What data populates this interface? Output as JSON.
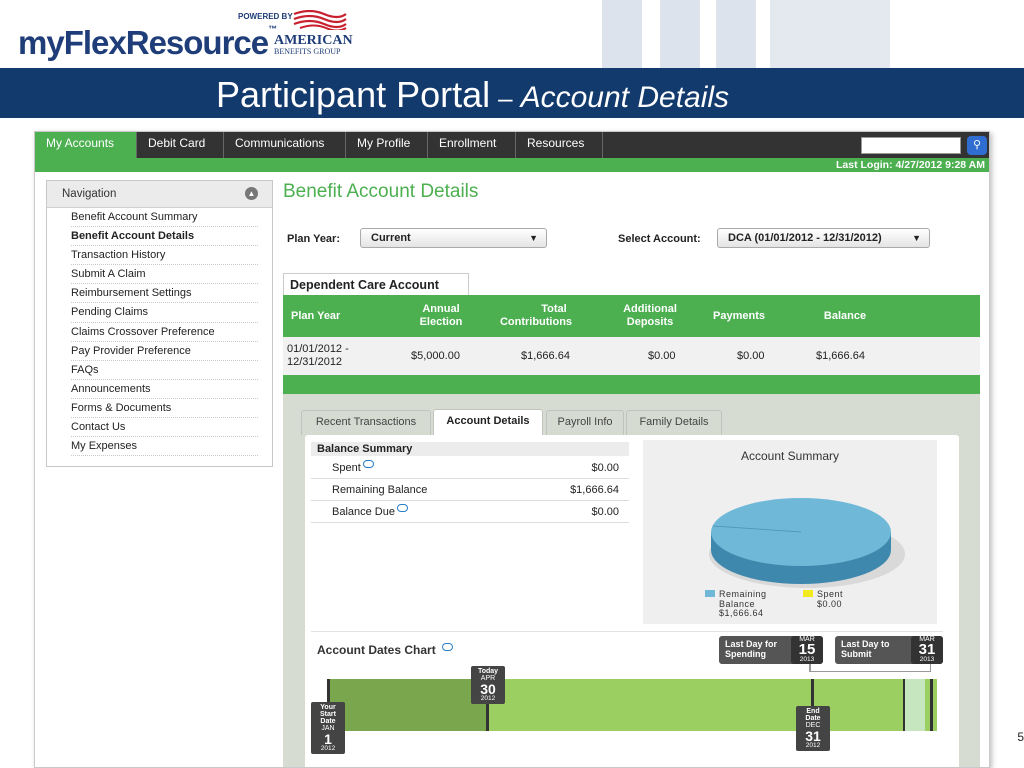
{
  "logo": {
    "brand_prefix": "my",
    "brand_main": "FlexResource",
    "trademark": "™",
    "powered_by": "POWERED BY",
    "partner_line1": "AMERICAN",
    "partner_line2": "BENEFITS GROUP"
  },
  "slide": {
    "title_main": "Participant Portal",
    "title_dash": "–",
    "title_sub": "Account Details",
    "page_number": "5"
  },
  "topnav": {
    "tabs": [
      "My Accounts",
      "Debit Card",
      "Communications",
      "My Profile",
      "Enrollment",
      "Resources"
    ],
    "active_index": 0,
    "last_login": "Last Login: 4/27/2012 9:28 AM"
  },
  "sidebar": {
    "title": "Navigation",
    "items": [
      "Benefit Account Summary",
      "Benefit Account Details",
      "Transaction History",
      "Submit A Claim",
      "Reimbursement Settings",
      "Pending Claims",
      "Claims Crossover Preference",
      "Pay Provider Preference",
      "FAQs",
      "Announcements",
      "Forms & Documents",
      "Contact Us",
      "My Expenses"
    ],
    "active_index": 1
  },
  "main": {
    "title": "Benefit Account Details",
    "plan_year_label": "Plan Year:",
    "plan_year_value": "Current",
    "select_account_label": "Select Account:",
    "select_account_value": "DCA (01/01/2012 - 12/31/2012)"
  },
  "account_table": {
    "tab_label": "Dependent Care Account",
    "headers": [
      "Plan Year",
      "Annual Election",
      "Total Contributions",
      "Additional Deposits",
      "Payments",
      "Balance"
    ],
    "header_lines": [
      [
        "Plan Year"
      ],
      [
        "Annual",
        "Election"
      ],
      [
        "Total",
        "Contributions"
      ],
      [
        "Additional",
        "Deposits"
      ],
      [
        "Payments"
      ],
      [
        "Balance"
      ]
    ],
    "row": {
      "plan_year_line1": "01/01/2012 -",
      "plan_year_line2": "12/31/2012",
      "annual_election": "$5,000.00",
      "total_contributions": "$1,666.64",
      "additional_deposits": "$0.00",
      "payments": "$0.00",
      "balance": "$1,666.64"
    }
  },
  "detail_tabs": {
    "tabs": [
      "Recent Transactions",
      "Account Details",
      "Payroll Info",
      "Family Details"
    ],
    "active_index": 1
  },
  "balance_summary": {
    "title": "Balance Summary",
    "rows": [
      {
        "label": "Spent",
        "value": "$0.00",
        "has_help": true
      },
      {
        "label": "Remaining Balance",
        "value": "$1,666.64",
        "has_help": false
      },
      {
        "label": "Balance Due",
        "value": "$0.00",
        "has_help": true
      }
    ]
  },
  "account_summary_chart": {
    "title": "Account Summary",
    "legend": [
      {
        "line1": "Remaining",
        "line2": "Balance",
        "line3": "$1,666.64",
        "color": "#6fb8d8"
      },
      {
        "line1": "Spent",
        "line2": "$0.00",
        "line3": "",
        "color": "#f2ea1c"
      }
    ]
  },
  "chart_data": {
    "type": "pie",
    "title": "Account Summary",
    "categories": [
      "Remaining Balance",
      "Spent"
    ],
    "values": [
      1666.64,
      0.0
    ]
  },
  "dates_chart": {
    "title": "Account Dates Chart",
    "last_day_spending": {
      "line1": "Last Day for",
      "line2": "Spending",
      "month": "MAR",
      "day": "15",
      "year": "2013"
    },
    "last_day_submit": {
      "line1": "Last Day to",
      "line2": "Submit",
      "month": "MAR",
      "day": "31",
      "year": "2013"
    },
    "today": {
      "label": "Today",
      "month": "APR",
      "day": "30",
      "year": "2012"
    },
    "start": {
      "label1": "Your",
      "label2": "Start",
      "label3": "Date",
      "month": "JAN",
      "day": "1",
      "year": "2012"
    },
    "end": {
      "label1": "End",
      "label2": "Date",
      "month": "DEC",
      "day": "31",
      "year": "2012"
    }
  },
  "colors": {
    "accent_green": "#4caf50",
    "title_navy": "#133a6d",
    "brand_blue": "#1f3d78",
    "pie_blue": "#6fb8d8"
  }
}
